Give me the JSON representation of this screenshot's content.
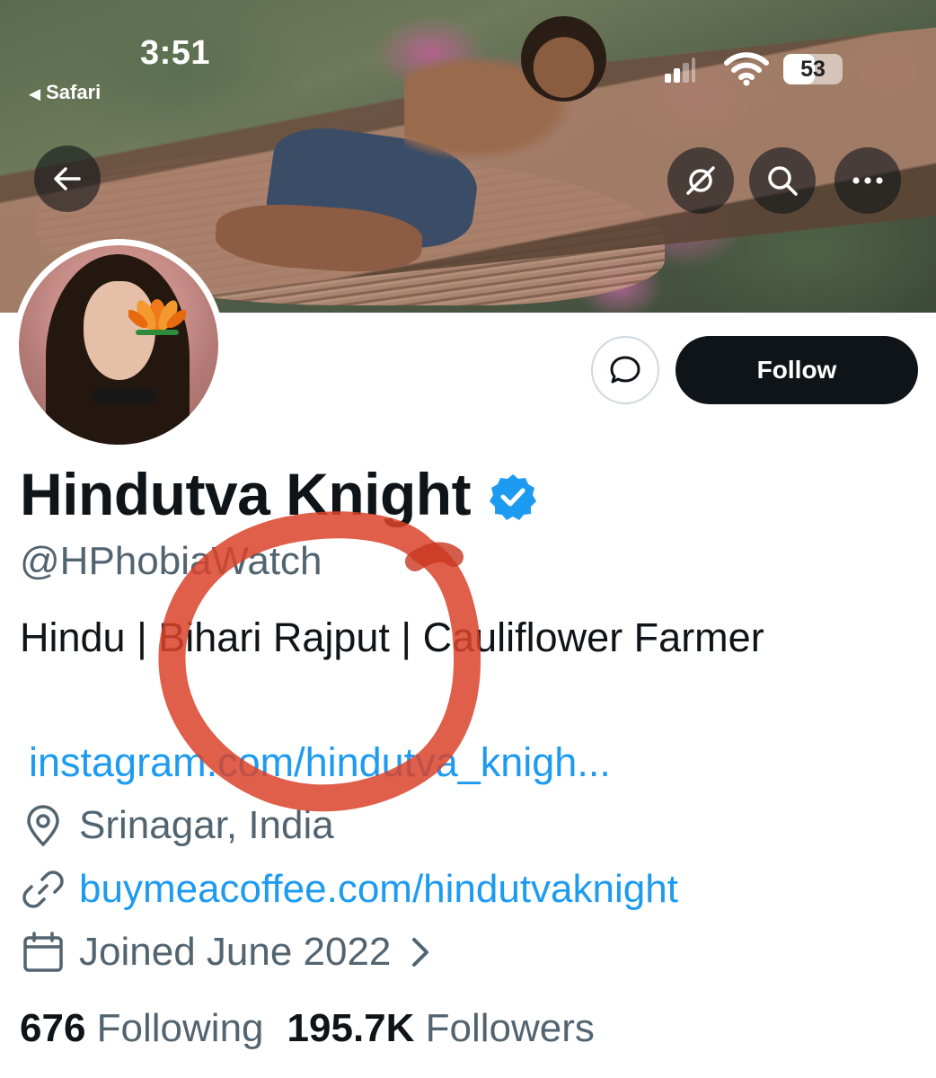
{
  "status_bar": {
    "time": "3:51",
    "back_app": "Safari",
    "battery": "53",
    "battery_level": 0.53
  },
  "banner": {
    "buttons": {
      "back": "back-arrow-icon",
      "unfollow_topics": "slashed-circle-icon",
      "search": "search-icon",
      "more": "more-icon"
    }
  },
  "actions": {
    "follow_label": "Follow",
    "message_icon": "message-bubble-icon"
  },
  "profile": {
    "display_name": "Hindutva Knight",
    "handle": "@HPhobiaWatch",
    "bio": "Hindu | Bihari Rajput | Cauliflower Farmer",
    "bio_link": "instagram.com/hindutva_knigh...",
    "location": "Srinagar, India",
    "website": "buymeacoffee.com/hindutvaknight",
    "joined": "Joined June 2022",
    "following_count": "676",
    "following_label": "Following",
    "followers_count": "195.7K",
    "followers_label": "Followers"
  },
  "colors": {
    "accent": "#1d9bf0",
    "text_primary": "#0f1419",
    "text_secondary": "#536471",
    "follow_bg": "#0f1419",
    "annotation": "#d9432a"
  }
}
